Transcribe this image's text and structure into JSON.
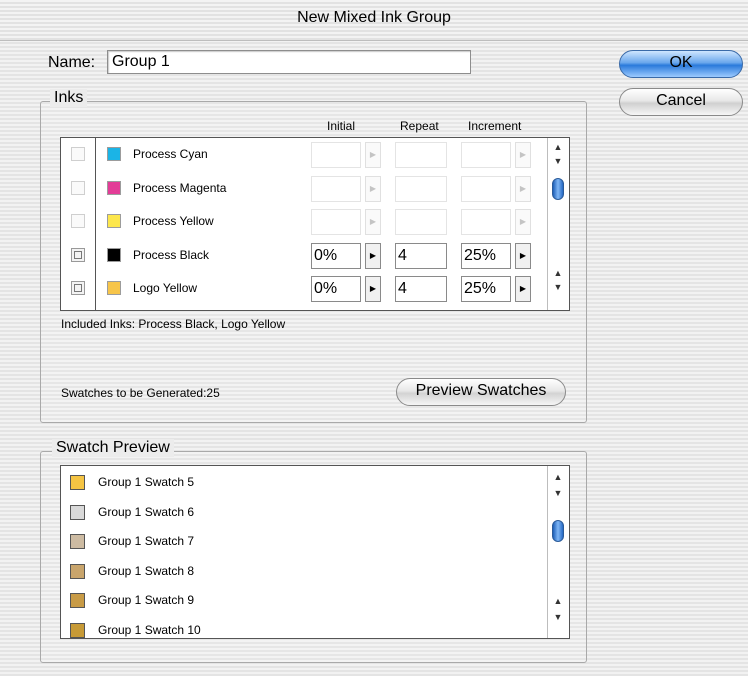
{
  "window": {
    "title": "New Mixed Ink Group"
  },
  "name_field": {
    "label": "Name:",
    "value": "Group 1"
  },
  "buttons": {
    "ok": "OK",
    "cancel": "Cancel",
    "preview": "Preview Swatches"
  },
  "inks": {
    "group_title": "Inks",
    "columns": {
      "initial": "Initial",
      "repeat": "Repeat",
      "increment": "Increment"
    },
    "rows": [
      {
        "name": "Process Cyan",
        "color": "#1bb4e6",
        "included": false,
        "initial": "",
        "repeat": "",
        "increment": ""
      },
      {
        "name": "Process Magenta",
        "color": "#e33c97",
        "included": false,
        "initial": "",
        "repeat": "",
        "increment": ""
      },
      {
        "name": "Process Yellow",
        "color": "#fde74c",
        "included": false,
        "initial": "",
        "repeat": "",
        "increment": ""
      },
      {
        "name": "Process Black",
        "color": "#000000",
        "included": true,
        "initial": "0%",
        "repeat": "4",
        "increment": "25%"
      },
      {
        "name": "Logo Yellow",
        "color": "#f7c54a",
        "included": true,
        "initial": "0%",
        "repeat": "4",
        "increment": "25%"
      }
    ],
    "included_text": "Included Inks: Process Black, Logo Yellow",
    "generated_text": "Swatches to be Generated:25"
  },
  "swatch_preview": {
    "group_title": "Swatch Preview",
    "items": [
      {
        "name": "Group 1 Swatch 5",
        "color": "#f5c443"
      },
      {
        "name": "Group 1 Swatch 6",
        "color": "#d9d9d9"
      },
      {
        "name": "Group 1 Swatch 7",
        "color": "#cdbba2"
      },
      {
        "name": "Group 1 Swatch 8",
        "color": "#c9a56c"
      },
      {
        "name": "Group 1 Swatch 9",
        "color": "#c89b46"
      },
      {
        "name": "Group 1 Swatch 10",
        "color": "#c79a36"
      }
    ]
  }
}
